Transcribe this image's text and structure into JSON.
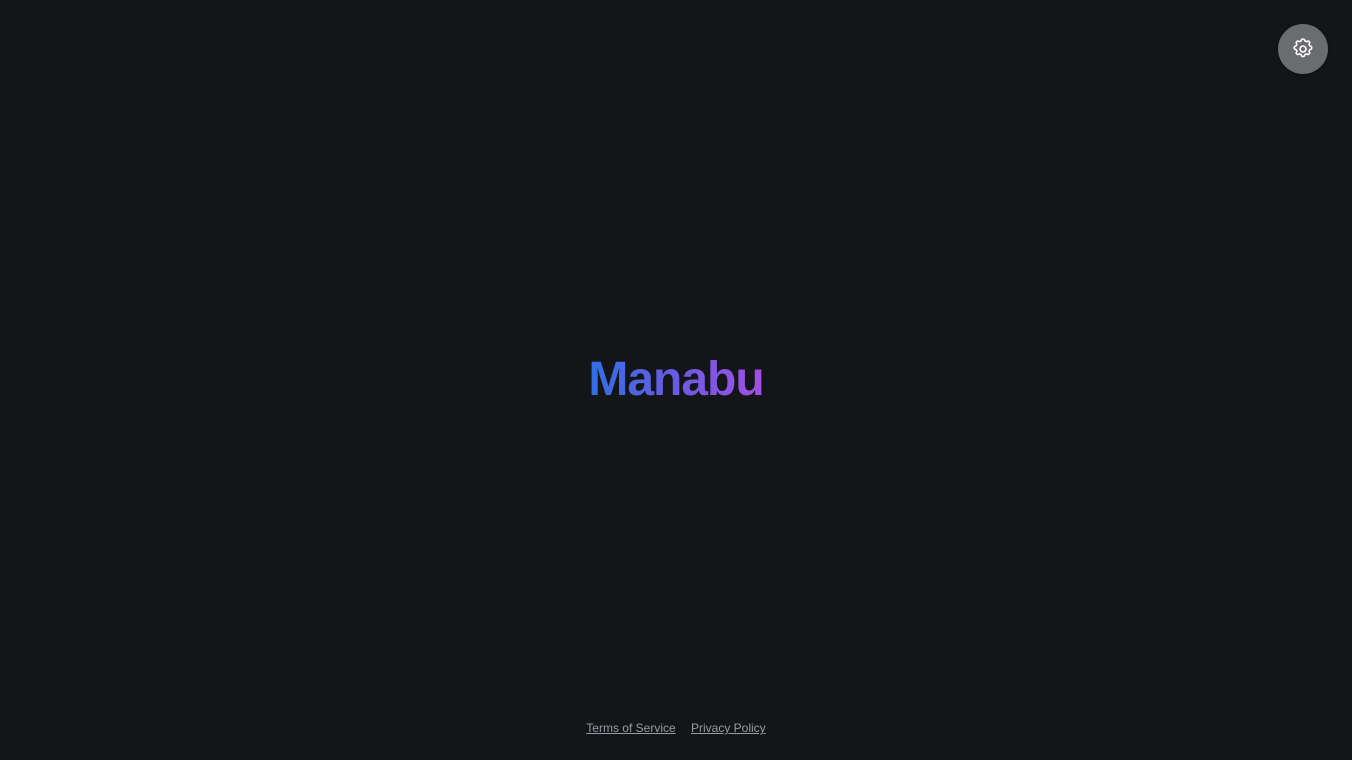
{
  "app": {
    "title": "Manabu"
  },
  "settings": {
    "icon": "gear-icon"
  },
  "footer": {
    "links": [
      {
        "label": "Terms of Service"
      },
      {
        "label": "Privacy Policy"
      }
    ]
  },
  "colors": {
    "background": "#131519",
    "settings_button": "#6b6c70",
    "brand_gradient_start": "#2f6fe6",
    "brand_gradient_end": "#a250e3",
    "footer_link": "#9a9ca3"
  }
}
